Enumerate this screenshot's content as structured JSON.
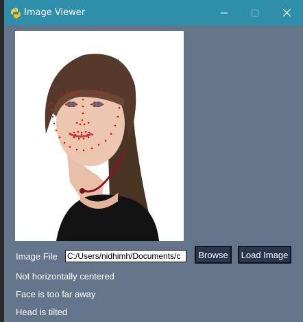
{
  "window": {
    "title": "Image Viewer"
  },
  "form": {
    "file_label": "Image File",
    "file_path": "C:/Users/nidhimh/Documents/c",
    "browse_label": "Browse",
    "load_label": "Load Image"
  },
  "status": {
    "lines": [
      "Not horizontally centered",
      "Face is too far away",
      "Head is tilted"
    ]
  },
  "colors": {
    "titlebar": "#2f8fab",
    "window_bg": "#64748b",
    "button_bg": "#2a3550",
    "landmark_dots": "#e01010"
  },
  "icons": {
    "app": "python-icon",
    "minimize": "minimize-icon",
    "maximize": "maximize-icon",
    "close": "close-icon"
  }
}
